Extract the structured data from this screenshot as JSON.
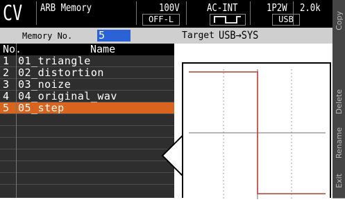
{
  "header": {
    "mode": "CV",
    "title": "ARB Memory",
    "voltage_range": "100V",
    "source": "AC-INT",
    "wiring": "1P2W",
    "current": "2.0k",
    "output_state": "OFF-L",
    "storage": "USB",
    "waveform_icon": "square-wave-icon"
  },
  "softkeys": [
    "Copy",
    "",
    "Delete",
    "Rename",
    "Exit"
  ],
  "infobar": {
    "memory_label": "Memory No.",
    "memory_value": "5",
    "target_label": "Target",
    "target_value": "USB→SYS"
  },
  "list": {
    "columns": [
      "No.",
      "Name"
    ],
    "rows": [
      {
        "no": "1",
        "name": "01_triangle"
      },
      {
        "no": "2",
        "name": "02_distortion"
      },
      {
        "no": "3",
        "name": "03_noize"
      },
      {
        "no": "4",
        "name": "04_original_wav"
      },
      {
        "no": "5",
        "name": "05_step"
      },
      {
        "no": "",
        "name": ""
      },
      {
        "no": "",
        "name": ""
      },
      {
        "no": "",
        "name": ""
      },
      {
        "no": "",
        "name": ""
      },
      {
        "no": "",
        "name": ""
      },
      {
        "no": "",
        "name": ""
      }
    ],
    "selected_index": 4
  },
  "colors": {
    "selected_row": "#d9641d",
    "waveform": "#c0392b",
    "input_highlight": "#2b63d6"
  },
  "preview": {
    "waveform_type": "step",
    "waveform_levels": [
      1,
      -1
    ]
  }
}
